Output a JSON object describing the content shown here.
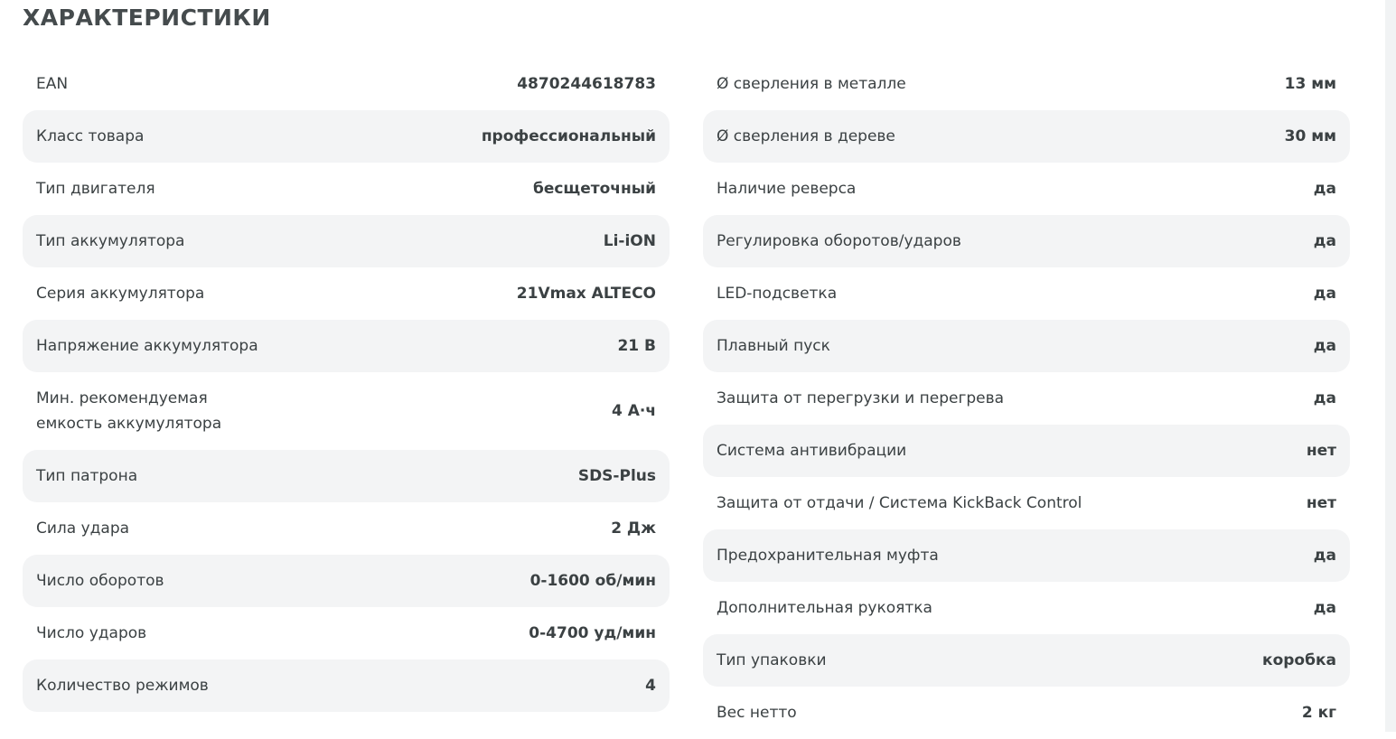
{
  "section": {
    "title": "ХАРАКТЕРИСТИКИ"
  },
  "left": [
    {
      "label": "EAN",
      "value": "4870244618783"
    },
    {
      "label": "Класс товара",
      "value": "профессиональный"
    },
    {
      "label": "Тип двигателя",
      "value": "бесщеточный"
    },
    {
      "label": "Тип аккумулятора",
      "value": "Li-iON"
    },
    {
      "label": "Серия аккумулятора",
      "value": "21Vmax ALTECO"
    },
    {
      "label": "Напряжение аккумулятора",
      "value": "21 В"
    },
    {
      "label": "Мин. рекомендуемая\nемкость аккумулятора",
      "value": "4 А·ч"
    },
    {
      "label": "Тип патрона",
      "value": "SDS-Plus"
    },
    {
      "label": "Сила удара",
      "value": "2 Дж"
    },
    {
      "label": "Число оборотов",
      "value": "0-1600 об/мин"
    },
    {
      "label": "Число ударов",
      "value": "0-4700 уд/мин"
    },
    {
      "label": "Количество режимов",
      "value": "4"
    }
  ],
  "right": [
    {
      "label": "Ø сверления в металле",
      "value": "13 мм"
    },
    {
      "label": "Ø сверления в дереве",
      "value": "30 мм"
    },
    {
      "label": "Наличие реверса",
      "value": "да"
    },
    {
      "label": "Регулировка оборотов/ударов",
      "value": "да"
    },
    {
      "label": "LED-подсветка",
      "value": "да"
    },
    {
      "label": "Плавный пуск",
      "value": "да"
    },
    {
      "label": "Защита от перегрузки и перегрева",
      "value": "да"
    },
    {
      "label": "Система антивибрации",
      "value": "нет"
    },
    {
      "label": "Защита от отдачи / Система KickBack Control",
      "value": "нет"
    },
    {
      "label": "Предохранительная муфта",
      "value": "да"
    },
    {
      "label": "Дополнительная рукоятка",
      "value": "да"
    },
    {
      "label": "Тип упаковки",
      "value": "коробка"
    },
    {
      "label": "Вес нетто",
      "value": "2 кг"
    }
  ],
  "colors": {
    "text": "#3b4143",
    "title": "#454b4d",
    "row_shade": "#f3f4f5"
  }
}
